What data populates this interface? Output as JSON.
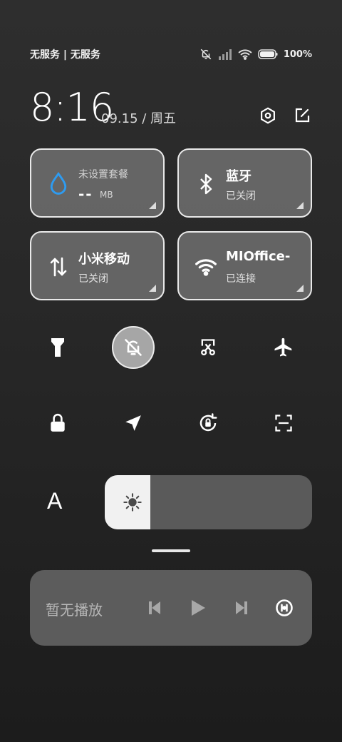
{
  "status_bar": {
    "carrier": "无服务 | 无服务",
    "battery": "100%"
  },
  "header": {
    "time": "8:16",
    "date": "09.15 / 周五"
  },
  "tiles": {
    "data": {
      "title": "未设置套餐",
      "value": "--",
      "unit": "MB"
    },
    "bluetooth": {
      "title": "蓝牙",
      "status": "已关闭"
    },
    "mobile": {
      "title": "小米移动",
      "status": "已关闭"
    },
    "wifi": {
      "title": "MIOffice-",
      "status": "已连接"
    }
  },
  "toggles": [
    "flashlight-icon",
    "mute-icon",
    "screenshot-icon",
    "airplane-icon",
    "lock-icon",
    "location-icon",
    "rotation-lock-icon",
    "scan-icon"
  ],
  "brightness": {
    "auto_label": "A",
    "level": 0.22
  },
  "media": {
    "label": "暂无播放"
  },
  "colors": {
    "tile_bg": "#969696",
    "active_toggle": "#a6a6a6",
    "media_bg": "#5c5c5c"
  }
}
